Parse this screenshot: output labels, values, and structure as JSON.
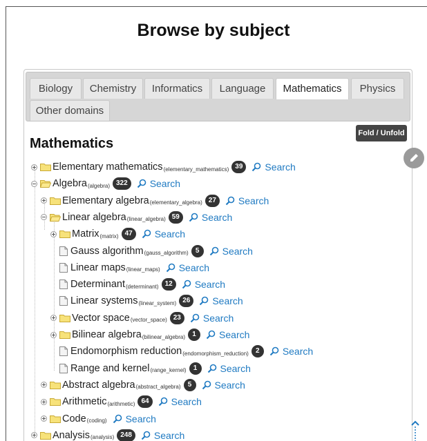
{
  "page": {
    "title": "Browse by subject"
  },
  "tabs": [
    {
      "label": "Biology",
      "active": false
    },
    {
      "label": "Chemistry",
      "active": false
    },
    {
      "label": "Informatics",
      "active": false
    },
    {
      "label": "Language",
      "active": false
    },
    {
      "label": "Mathematics",
      "active": true
    },
    {
      "label": "Physics",
      "active": false
    },
    {
      "label": "Other domains",
      "active": false
    }
  ],
  "fold_unfold_label": "Fold / Unfold",
  "section_title": "Mathematics",
  "search_label": "Search",
  "colors": {
    "link": "#1f7ac2",
    "badge": "#333333",
    "folder_fill": "#f7e27a",
    "folder_stroke": "#c9a934"
  },
  "icons": {
    "edit": "pencil-icon",
    "search": "magnifier-icon",
    "scroll_top": "arrow-up-icon"
  },
  "tree": [
    {
      "label": "Elementary mathematics",
      "slug": "(elementary_mathematics)",
      "count": "39",
      "type": "folder",
      "expanded": false
    },
    {
      "label": "Algebra",
      "slug": "(algebra)",
      "count": "322",
      "type": "folder",
      "expanded": true
    },
    {
      "label": "Elementary algebra",
      "slug": "(elementary_algebra)",
      "count": "27",
      "type": "folder",
      "expanded": false
    },
    {
      "label": "Linear algebra",
      "slug": "(linear_algebra)",
      "count": "59",
      "type": "folder",
      "expanded": true
    },
    {
      "label": "Matrix",
      "slug": "(matrix)",
      "count": "47",
      "type": "folder",
      "expanded": false
    },
    {
      "label": "Gauss algorithm",
      "slug": "(gauss_algorithm)",
      "count": "5",
      "type": "doc"
    },
    {
      "label": "Linear maps",
      "slug": "(linear_maps)",
      "count": "",
      "type": "doc"
    },
    {
      "label": "Determinant",
      "slug": "(determinant)",
      "count": "12",
      "type": "doc"
    },
    {
      "label": "Linear systems",
      "slug": "(linear_system)",
      "count": "26",
      "type": "doc"
    },
    {
      "label": "Vector space",
      "slug": "(vector_space)",
      "count": "23",
      "type": "folder",
      "expanded": false
    },
    {
      "label": "Bilinear algebra",
      "slug": "(bilinear_algebra)",
      "count": "1",
      "type": "folder",
      "expanded": false
    },
    {
      "label": "Endomorphism reduction",
      "slug": "(endomorphism_reduction)",
      "count": "2",
      "type": "doc"
    },
    {
      "label": "Range and kernel",
      "slug": "(range_kernel)",
      "count": "1",
      "type": "doc"
    },
    {
      "label": "Abstract algebra",
      "slug": "(abstract_algebra)",
      "count": "5",
      "type": "folder",
      "expanded": false
    },
    {
      "label": "Arithmetic",
      "slug": "(arithmetic)",
      "count": "64",
      "type": "folder",
      "expanded": false
    },
    {
      "label": "Code",
      "slug": "(coding)",
      "count": "",
      "type": "folder",
      "expanded": false
    },
    {
      "label": "Analysis",
      "slug": "(analysis)",
      "count": "248",
      "type": "folder",
      "expanded": false
    }
  ]
}
